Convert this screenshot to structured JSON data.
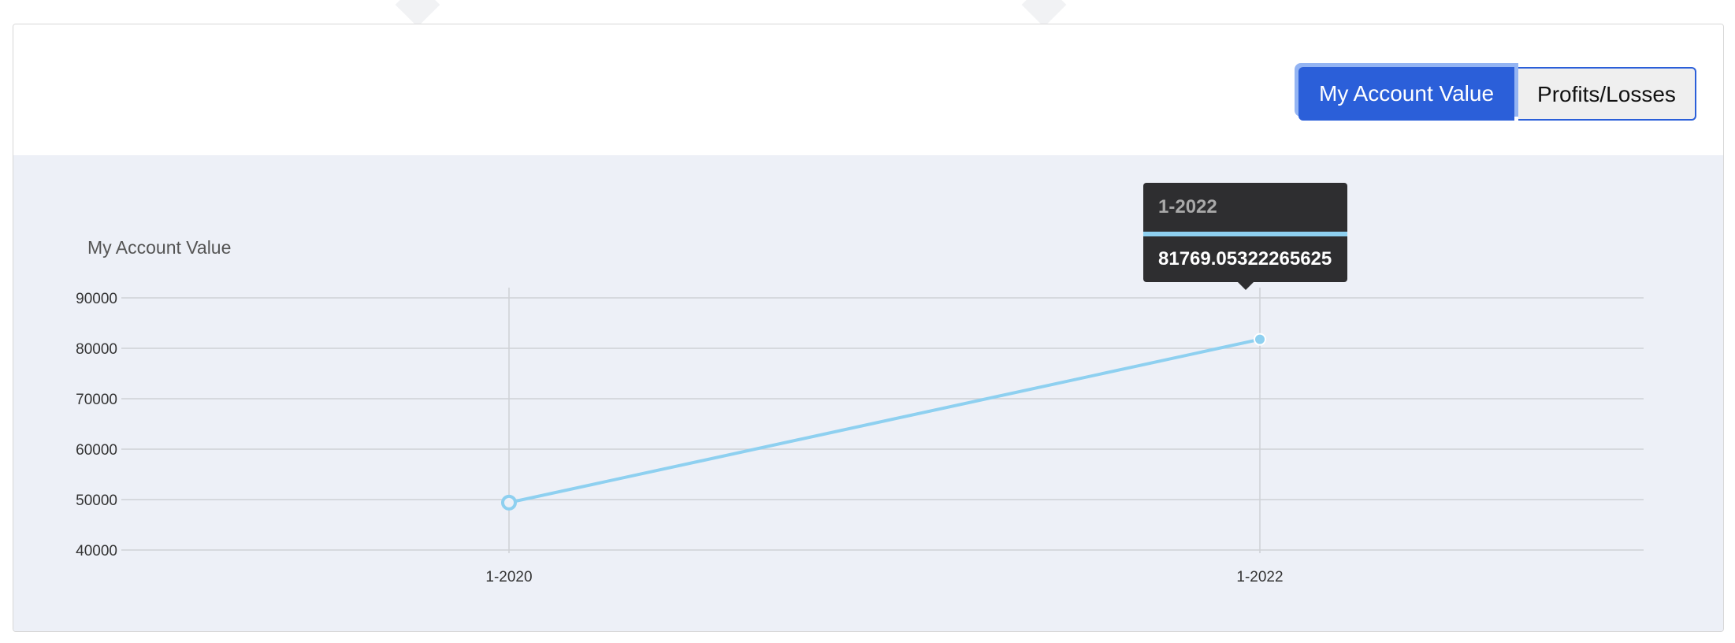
{
  "toolbar": {
    "account_value_label": "My Account Value",
    "profits_losses_label": "Profits/Losses",
    "active_tab": "My Account Value"
  },
  "colors": {
    "accent": "#2b5fd9",
    "series_line": "#8ed0f0",
    "plot_background": "#edf0f7",
    "tooltip_background": "#2e2e30"
  },
  "chart_data": {
    "type": "line",
    "title": "My Account Value",
    "xlabel": "",
    "ylabel": "",
    "categories": [
      "1-2020",
      "1-2022"
    ],
    "series": [
      {
        "values": [
          49400,
          81769.05322265625
        ]
      }
    ],
    "ylim": [
      40000,
      90000
    ],
    "yticks": [
      90000,
      80000,
      70000,
      60000,
      50000,
      40000
    ],
    "grid": true,
    "legend": "none"
  },
  "tooltip": {
    "title": "1-2022",
    "value": "81769.05322265625"
  }
}
